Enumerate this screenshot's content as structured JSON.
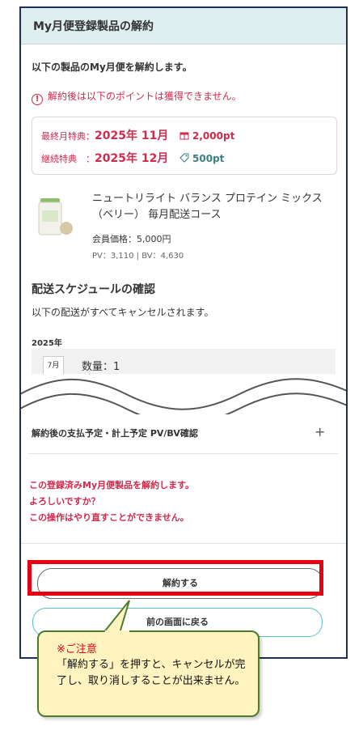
{
  "header": {
    "title": "My月便登録製品の解約"
  },
  "intro": "以下の製品のMy月便を解約します。",
  "warning": {
    "icon": "alert-circle-icon",
    "text": "解約後は以下のポイントは獲得できません。"
  },
  "points": {
    "final": {
      "label": "最終月特典：",
      "date": "2025年 11月",
      "icon": "gift-icon",
      "amount": "2,000pt"
    },
    "continuing": {
      "label": "継続特典　：",
      "date": "2025年 12月",
      "icon": "tag-icon",
      "amount": "500pt"
    }
  },
  "product": {
    "name": "ニュートリライト バランス プロテイン ミックス（ベリー） 毎月配送コース",
    "price": "会員価格：5,000円",
    "pvbv": "PV：3,110 | BV：4,630"
  },
  "schedule": {
    "title": "配送スケジュールの確認",
    "text": "以下の配送がすべてキャンセルされます。",
    "year": "2025年",
    "month": "7月",
    "qty": "数量：1"
  },
  "accordion": {
    "label": "解約後の支払予定・計上予定 PV/BV確認",
    "icon": "plus-icon"
  },
  "confirm": {
    "line1": "この登録済みMy月便製品を解約します。",
    "line2": "よろしいですか？",
    "line3": "この操作はやり直すことができません。"
  },
  "buttons": {
    "cancel": "解約する",
    "back": "前の画面に戻る"
  },
  "callout": {
    "title": "※ご注意",
    "text": "「解約する」を押すと、キャンセルが完了し、取り消しすることが出来ません。"
  },
  "colors": {
    "accent_red": "#d02a4c",
    "highlight_red": "#e60012",
    "teal": "#5bc0bf",
    "header_bg": "#dfeeee"
  }
}
